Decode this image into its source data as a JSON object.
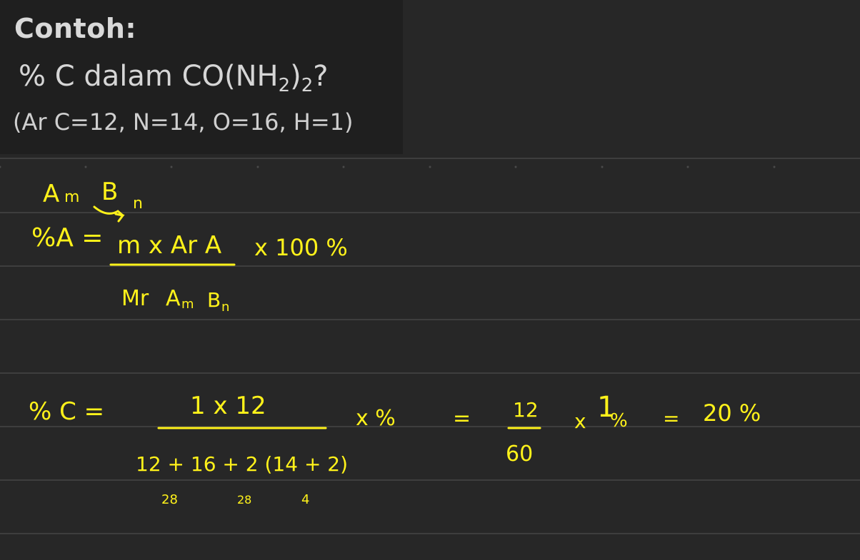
{
  "colors": {
    "background": "#272727",
    "panel": "#1f1f1f",
    "rule_line": "#3e3e3e",
    "ink": "#fff21a"
  },
  "example": {
    "title": "Contoh:",
    "question_prefix": "% C dalam CO(NH",
    "question_sub1": "2",
    "question_mid": ")",
    "question_sub2": "2",
    "question_suffix": "?",
    "given": "(Ar C=12, N=14, O=16, H=1)"
  },
  "handwriting": {
    "compound_A": "A",
    "compound_m": "m",
    "compound_B": "B",
    "compound_n": "n",
    "formula_lhs": "%A =",
    "formula_numerator": "m x Ar A",
    "formula_times": "x 100 %",
    "formula_denominator_mr": "Mr",
    "formula_denominator_A": "A",
    "formula_denominator_m": "m",
    "formula_denominator_B": "B",
    "formula_denominator_n": "n",
    "calc_lhs": "% C =",
    "calc_numerator": "1  x 12",
    "calc_denominator": "12 + 16 + 2 (14 + 2)",
    "calc_times": "x %",
    "calc_eq1": "=",
    "calc_frac_num": "12",
    "calc_frac_den": "60",
    "calc_times2": "x",
    "calc_one": "1",
    "calc_percent": "%",
    "calc_eq2": "=",
    "calc_result": "20 %",
    "note_28a": "28",
    "note_28b": "28",
    "note_4": "4"
  }
}
